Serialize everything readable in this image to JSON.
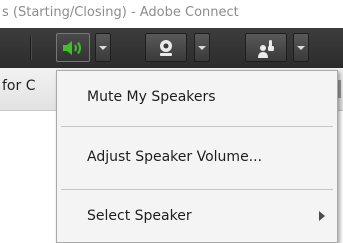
{
  "window": {
    "title": "s (Starting/Closing) - Adobe Connect"
  },
  "toolbar": {
    "buttons": [
      {
        "icon": "speaker-icon",
        "color": "#3fbf2a",
        "state": "active"
      },
      {
        "icon": "webcam-icon"
      },
      {
        "icon": "raise-hand-icon"
      }
    ]
  },
  "pod": {
    "label": "for C"
  },
  "menu": {
    "items": [
      {
        "label": "Mute My Speakers"
      },
      {
        "label": "Adjust Speaker Volume..."
      },
      {
        "label": "Select Speaker",
        "has_submenu": true
      }
    ]
  }
}
